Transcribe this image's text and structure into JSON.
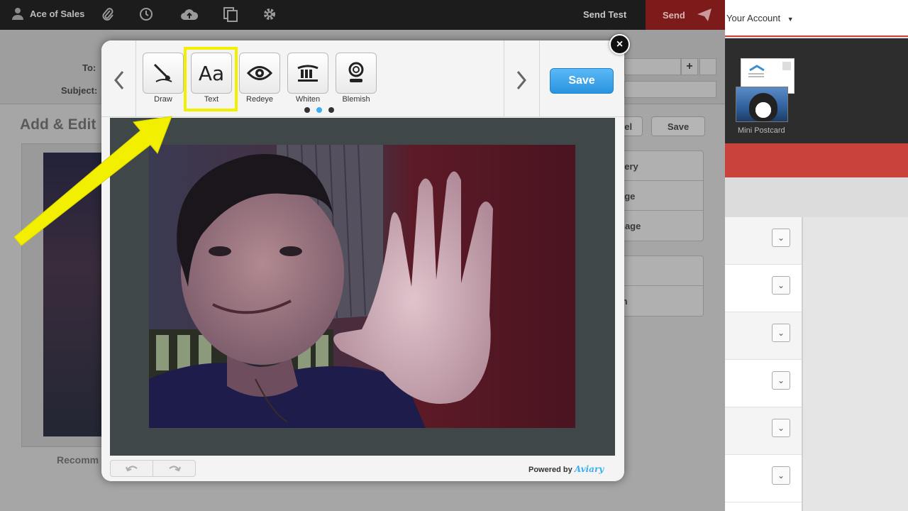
{
  "topbar": {
    "user_name": "Ace of Sales",
    "send_test_label": "Send Test",
    "send_label": "Send",
    "icons": [
      "user-icon",
      "paperclip-icon",
      "clock-icon",
      "cloud-upload-icon",
      "copy-icon",
      "gear-icon",
      "paper-plane-icon"
    ]
  },
  "background_editor": {
    "to_label": "To:",
    "subject_label": "Subject:",
    "title": "Add & Edit",
    "cancel_label": "cel",
    "save_label": "Save",
    "options": [
      "llery",
      "age",
      "nage"
    ],
    "options2": [
      "",
      "m"
    ],
    "recommend_label": "Recomm"
  },
  "right_panel": {
    "account_label": "Your Account",
    "postcard_caption": "Mini Postcard",
    "row_count": 6
  },
  "editor": {
    "tools": [
      {
        "label": "Draw",
        "icon": "brush-icon"
      },
      {
        "label": "Text",
        "icon": "text-icon",
        "glyph": "Aa"
      },
      {
        "label": "Redeye",
        "icon": "eye-icon"
      },
      {
        "label": "Whiten",
        "icon": "teeth-icon"
      },
      {
        "label": "Blemish",
        "icon": "blemish-icon"
      }
    ],
    "page_dots": 3,
    "active_page": 2,
    "save_label": "Save",
    "powered_by": "Powered by",
    "brand": "Aviary",
    "close_symbol": "×"
  },
  "colors": {
    "highlight": "#f2f000",
    "save_blue": "#2a93e0",
    "send_red": "#7d1b1b",
    "accent_red": "#c9423c"
  }
}
